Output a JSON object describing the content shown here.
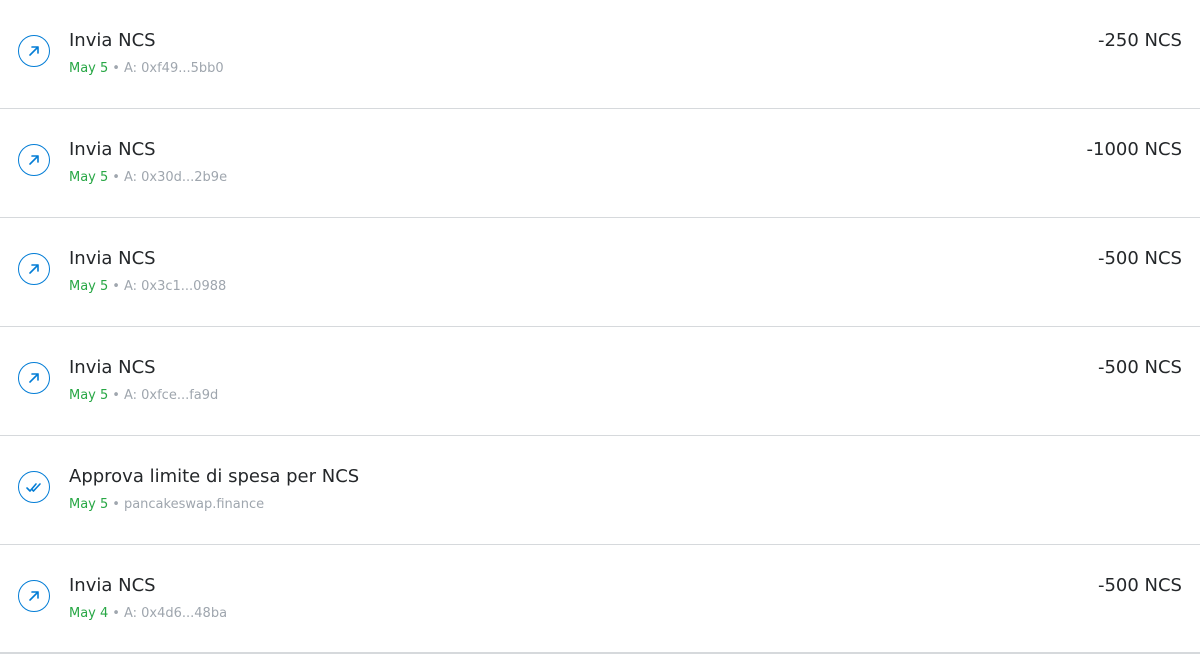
{
  "colors": {
    "icon_blue": "#037dd6",
    "date_green": "#28a745",
    "muted_gray": "#9fa6ae",
    "divider": "#d6d9dc"
  },
  "transactions": [
    {
      "icon": "arrow-up-right-icon",
      "title": "Invia NCS",
      "date": "May 5",
      "separator": "•",
      "target": "A: 0xf49...5bb0",
      "amount": "-250 NCS"
    },
    {
      "icon": "arrow-up-right-icon",
      "title": "Invia NCS",
      "date": "May 5",
      "separator": "•",
      "target": "A: 0x30d...2b9e",
      "amount": "-1000 NCS"
    },
    {
      "icon": "arrow-up-right-icon",
      "title": "Invia NCS",
      "date": "May 5",
      "separator": "•",
      "target": "A: 0x3c1...0988",
      "amount": "-500 NCS"
    },
    {
      "icon": "arrow-up-right-icon",
      "title": "Invia NCS",
      "date": "May 5",
      "separator": "•",
      "target": "A: 0xfce...fa9d",
      "amount": "-500 NCS"
    },
    {
      "icon": "double-check-icon",
      "title": "Approva limite di spesa per NCS",
      "date": "May 5",
      "separator": "•",
      "target": "pancakeswap.finance",
      "amount": ""
    },
    {
      "icon": "arrow-up-right-icon",
      "title": "Invia NCS",
      "date": "May 4",
      "separator": "•",
      "target": "A: 0x4d6...48ba",
      "amount": "-500 NCS"
    }
  ]
}
